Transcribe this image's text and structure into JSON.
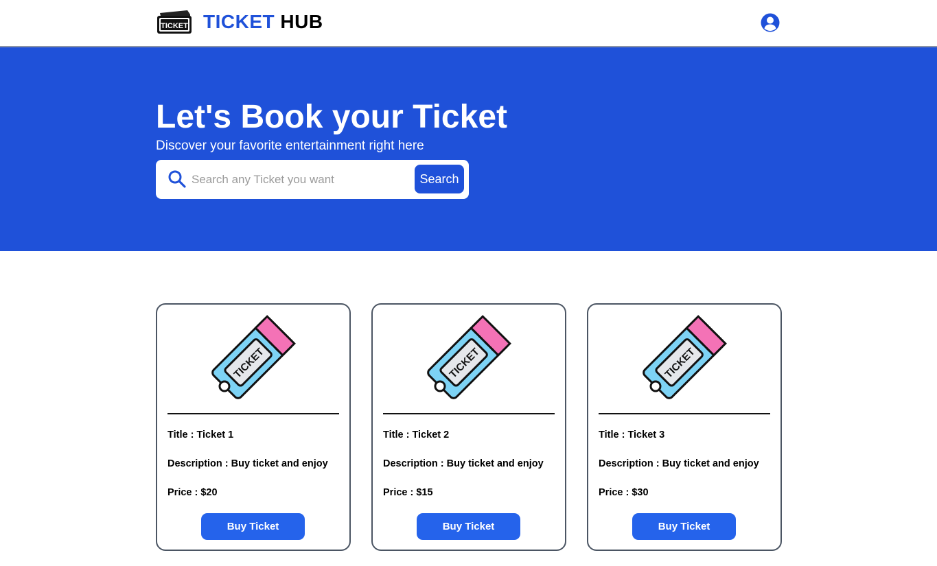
{
  "header": {
    "logo_text": "TICKET",
    "brand_part1": "TICKET",
    "brand_part2": "HUB",
    "profile_icon": "user-circle-icon"
  },
  "hero": {
    "title": "Let's Book your Ticket",
    "subtitle": "Discover your favorite entertainment right here",
    "search": {
      "placeholder": "Search any Ticket you want",
      "value": "",
      "button_label": "Search",
      "icon": "search-icon"
    }
  },
  "colors": {
    "brand_blue": "#1f51d9",
    "button_blue": "#2563eb",
    "ticket_body": "#7dd3f5",
    "ticket_stub": "#f472b6"
  },
  "cards": [
    {
      "image_label": "TICKET",
      "title_label": "Title : ",
      "title": "Ticket 1",
      "desc_label": "Description : ",
      "description": "Buy ticket and enjoy",
      "price_label": "Price : ",
      "price": "$20",
      "button_label": "Buy Ticket"
    },
    {
      "image_label": "TICKET",
      "title_label": "Title : ",
      "title": "Ticket 2",
      "desc_label": "Description : ",
      "description": "Buy ticket and enjoy",
      "price_label": "Price : ",
      "price": "$15",
      "button_label": "Buy Ticket"
    },
    {
      "image_label": "TICKET",
      "title_label": "Title : ",
      "title": "Ticket 3",
      "desc_label": "Description : ",
      "description": "Buy ticket and enjoy",
      "price_label": "Price : ",
      "price": "$30",
      "button_label": "Buy Ticket"
    }
  ]
}
